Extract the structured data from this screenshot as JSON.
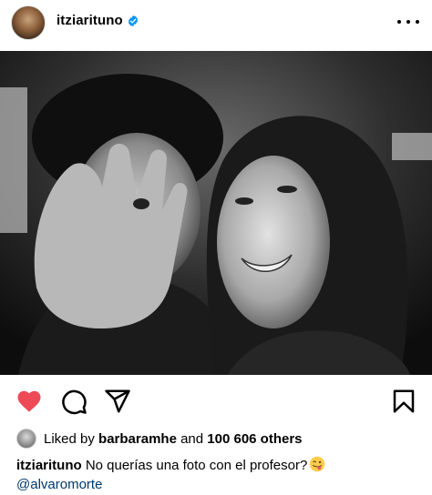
{
  "header": {
    "username": "itziarituno",
    "verified": true,
    "more_icon": "more-horizontal-icon"
  },
  "post": {
    "photo_icon": "photo",
    "liked": true
  },
  "actions": {
    "like_icon": "heart-filled-icon",
    "comment_icon": "comment-icon",
    "share_icon": "paper-plane-icon",
    "save_icon": "bookmark-icon",
    "like_color": "#ed4956"
  },
  "likes": {
    "prefix": "Liked by ",
    "liker": "barbaramhe",
    "middle": " and ",
    "count": "100 606 others"
  },
  "caption": {
    "username": "itziarituno",
    "text": "No querías una foto con el profesor?",
    "mention": "@alvaromorte"
  },
  "colors": {
    "link": "#00376b",
    "verified": "#0095f6"
  }
}
